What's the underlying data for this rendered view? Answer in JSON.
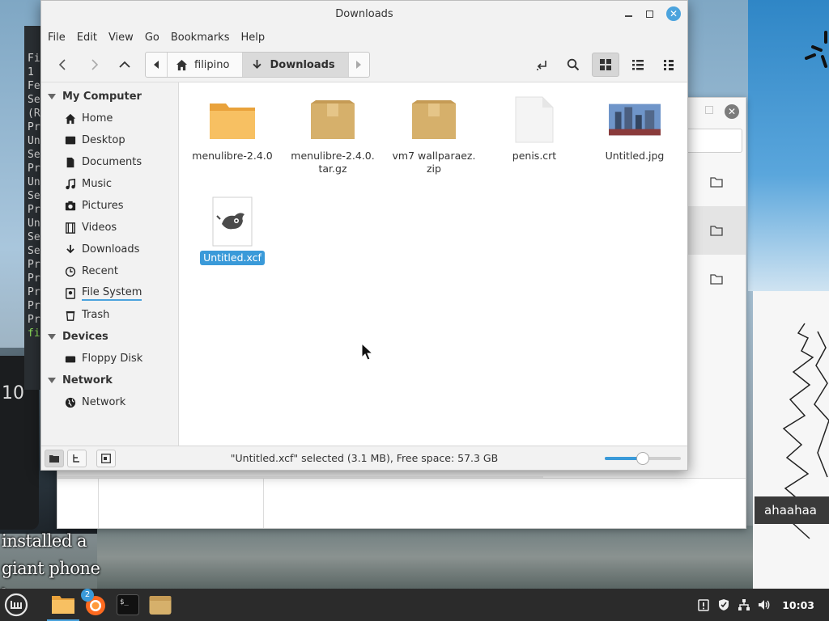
{
  "window": {
    "title": "Downloads"
  },
  "menubar": [
    "File",
    "Edit",
    "View",
    "Go",
    "Bookmarks",
    "Help"
  ],
  "pathbar": {
    "segments": [
      {
        "label": "filipino",
        "icon": "home-icon"
      },
      {
        "label": "Downloads",
        "icon": "download-icon",
        "active": true
      }
    ]
  },
  "sidebar": {
    "sections": [
      {
        "header": "My Computer",
        "items": [
          {
            "label": "Home",
            "icon": "home-icon"
          },
          {
            "label": "Desktop",
            "icon": "desktop-icon"
          },
          {
            "label": "Documents",
            "icon": "document-icon"
          },
          {
            "label": "Music",
            "icon": "music-icon"
          },
          {
            "label": "Pictures",
            "icon": "picture-icon"
          },
          {
            "label": "Videos",
            "icon": "video-icon"
          },
          {
            "label": "Downloads",
            "icon": "download-icon"
          },
          {
            "label": "Recent",
            "icon": "clock-icon"
          },
          {
            "label": "File System",
            "icon": "filesystem-icon"
          },
          {
            "label": "Trash",
            "icon": "trash-icon"
          }
        ]
      },
      {
        "header": "Devices",
        "items": [
          {
            "label": "Floppy Disk",
            "icon": "drive-icon"
          }
        ]
      },
      {
        "header": "Network",
        "items": [
          {
            "label": "Network",
            "icon": "globe-icon"
          }
        ]
      }
    ]
  },
  "files": [
    {
      "name": "menulibre-2.4.0",
      "icon": "folder-icon"
    },
    {
      "name": "menulibre-2.4.0.\ntar.gz",
      "icon": "archive-icon"
    },
    {
      "name": "vm7 wallparaez.\nzip",
      "icon": "archive-icon"
    },
    {
      "name": "penis.crt",
      "icon": "blank-file-icon"
    },
    {
      "name": "Untitled.jpg",
      "icon": "image-thumbnail-icon"
    },
    {
      "name": "Untitled.xcf",
      "icon": "gimp-file-icon",
      "selected": true
    }
  ],
  "statusbar": {
    "text": "\"Untitled.xcf\" selected (3.1 MB), Free space: 57.3 GB",
    "zoom_level": 0.5
  },
  "background": {
    "terminal_lines": [
      "Fi",
      "1",
      "Fe",
      "Se",
      "(R",
      "Pr",
      "Un",
      "Se",
      "Pr",
      "Un",
      "Se",
      "Pr",
      "Un",
      "Se",
      "Se",
      "Pr",
      "Pr",
      "Pr",
      "Pr",
      "Pr",
      "fi"
    ],
    "meme_text": "installed a giant phone here",
    "right_text": "ahaahaa",
    "phone_text": "10"
  },
  "taskbar": {
    "apps": [
      {
        "name": "file-manager-icon",
        "active": true
      },
      {
        "name": "firefox-icon",
        "badge": "2"
      },
      {
        "name": "terminal-icon"
      },
      {
        "name": "archive-manager-icon"
      }
    ],
    "clock": "10:03"
  },
  "colors": {
    "accent": "#3a9ad9",
    "folder": "#f4b350",
    "archive": "#d6b06b"
  }
}
